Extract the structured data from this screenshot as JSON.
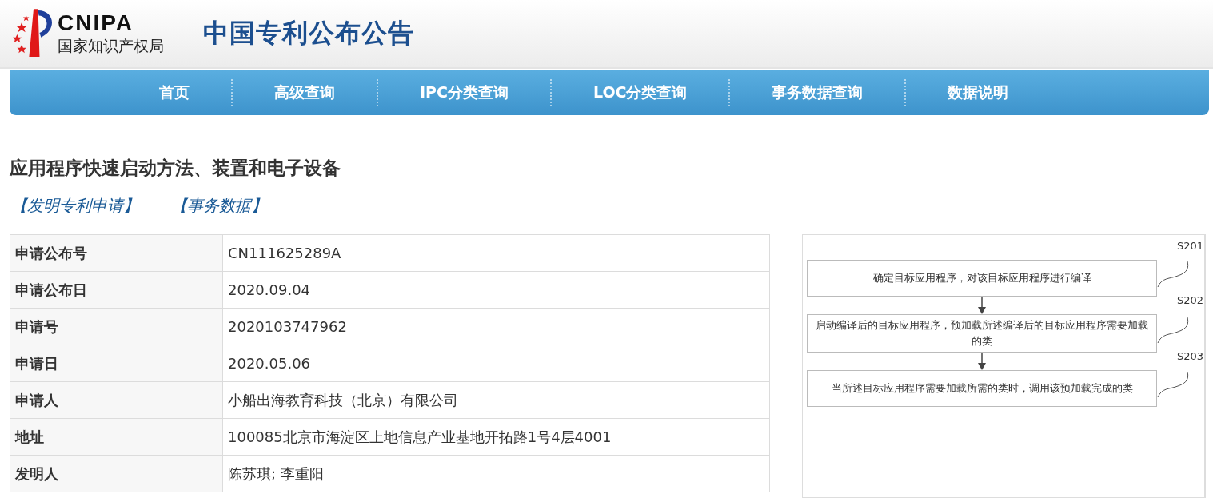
{
  "header": {
    "logo_abbr": "CNIPA",
    "logo_name": "国家知识产权局",
    "site_title": "中国专利公布公告"
  },
  "nav": [
    {
      "label": "首页"
    },
    {
      "label": "高级查询"
    },
    {
      "label": "IPC分类查询"
    },
    {
      "label": "LOC分类查询"
    },
    {
      "label": "事务数据查询"
    },
    {
      "label": "数据说明"
    }
  ],
  "patent_title": "应用程序快速启动方法、装置和电子设备",
  "links": [
    {
      "label": "【发明专利申请】"
    },
    {
      "label": "【事务数据】"
    }
  ],
  "table": {
    "rows": [
      {
        "label": "申请公布号",
        "value": "CN111625289A"
      },
      {
        "label": "申请公布日",
        "value": "2020.09.04"
      },
      {
        "label": "申请号",
        "value": "2020103747962"
      },
      {
        "label": "申请日",
        "value": "2020.05.06"
      },
      {
        "label": "申请人",
        "value": "小船出海教育科技（北京）有限公司"
      },
      {
        "label": "地址",
        "value": "100085北京市海淀区上地信息产业基地开拓路1号4层4001"
      },
      {
        "label": "发明人",
        "value": "陈苏琪; 李重阳"
      }
    ]
  },
  "figure": {
    "steps": [
      {
        "code": "S201",
        "text": "确定目标应用程序，对该目标应用程序进行编译"
      },
      {
        "code": "S202",
        "text": "启动编译后的目标应用程序，预加载所述编译后的目标应用程序需要加载的类"
      },
      {
        "code": "S203",
        "text": "当所述目标应用程序需要加载所需的类时，调用该预加载完成的类"
      }
    ]
  }
}
